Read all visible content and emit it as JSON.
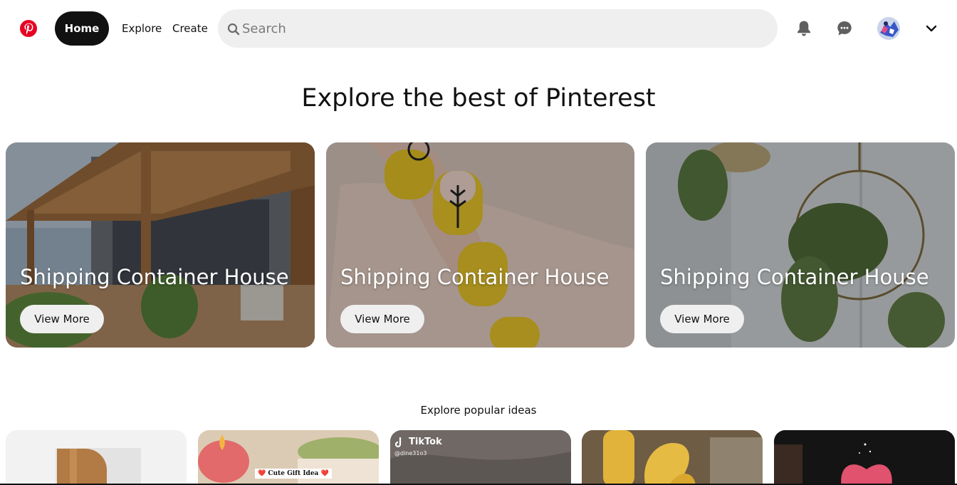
{
  "header": {
    "logo_icon": "pinterest-logo-icon",
    "brand_color": "#e60023",
    "nav": {
      "home_label": "Home",
      "explore_label": "Explore",
      "create_label": "Create"
    },
    "search": {
      "placeholder": "Search",
      "value": ""
    },
    "icons": [
      "bell-icon",
      "chat-bubble-icon",
      "avatar",
      "chevron-down-icon"
    ]
  },
  "main": {
    "title": "Explore the best of Pinterest",
    "cards": [
      {
        "title": "Shipping Container House",
        "button_label": "View More"
      },
      {
        "title": "Shipping Container House",
        "button_label": "View More"
      },
      {
        "title": "Shipping Container House",
        "button_label": "View More"
      }
    ]
  },
  "popular": {
    "title": "Explore popular ideas",
    "tiles": [
      {
        "label": ""
      },
      {
        "label": "❤️ Cute Gift Idea ❤️"
      },
      {
        "label": "TikTok",
        "handle": "@dine31o3"
      },
      {
        "label": ""
      },
      {
        "label": ""
      }
    ]
  }
}
